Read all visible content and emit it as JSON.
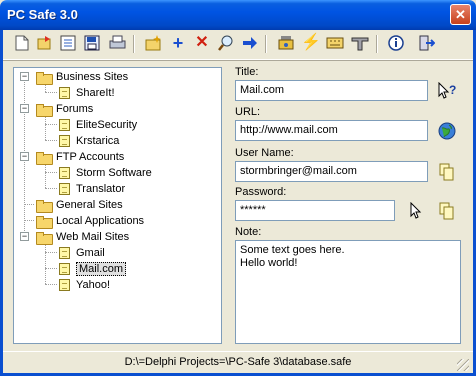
{
  "window": {
    "title": "PC Safe 3.0"
  },
  "toolbar": {
    "icons": [
      "new-document-icon",
      "open-icon",
      "properties-icon",
      "save-icon",
      "print-icon",
      "new-folder-icon",
      "add-icon",
      "delete-icon",
      "search-icon",
      "go-arrow-icon",
      "settings-icon",
      "lightning-icon",
      "generator-icon",
      "tools-icon",
      "info-icon",
      "exit-icon"
    ]
  },
  "tree": {
    "groups": [
      {
        "label": "Business Sites",
        "children": [
          "ShareIt!"
        ]
      },
      {
        "label": "Forums",
        "children": [
          "EliteSecurity",
          "Krstarica"
        ]
      },
      {
        "label": "FTP Accounts",
        "children": [
          "Storm Software",
          "Translator"
        ]
      },
      {
        "label": "General Sites",
        "children": []
      },
      {
        "label": "Local Applications",
        "children": []
      },
      {
        "label": "Web Mail Sites",
        "children": [
          "Gmail",
          "Mail.com",
          "Yahoo!"
        ]
      }
    ],
    "selected": "Mail.com"
  },
  "form": {
    "title_label": "Title:",
    "title_value": "Mail.com",
    "url_label": "URL:",
    "url_value": "http://www.mail.com",
    "username_label": "User Name:",
    "username_value": "stormbringer@mail.com",
    "password_label": "Password:",
    "password_value": "******",
    "note_label": "Note:",
    "note_value": "Some text goes here.\nHello world!"
  },
  "status": {
    "path": "D:\\=Delphi Projects=\\PC-Safe 3\\database.safe"
  },
  "colors": {
    "titlebar": "#0054e3",
    "window_bg": "#ece9d8",
    "field_border": "#7f9db9"
  }
}
